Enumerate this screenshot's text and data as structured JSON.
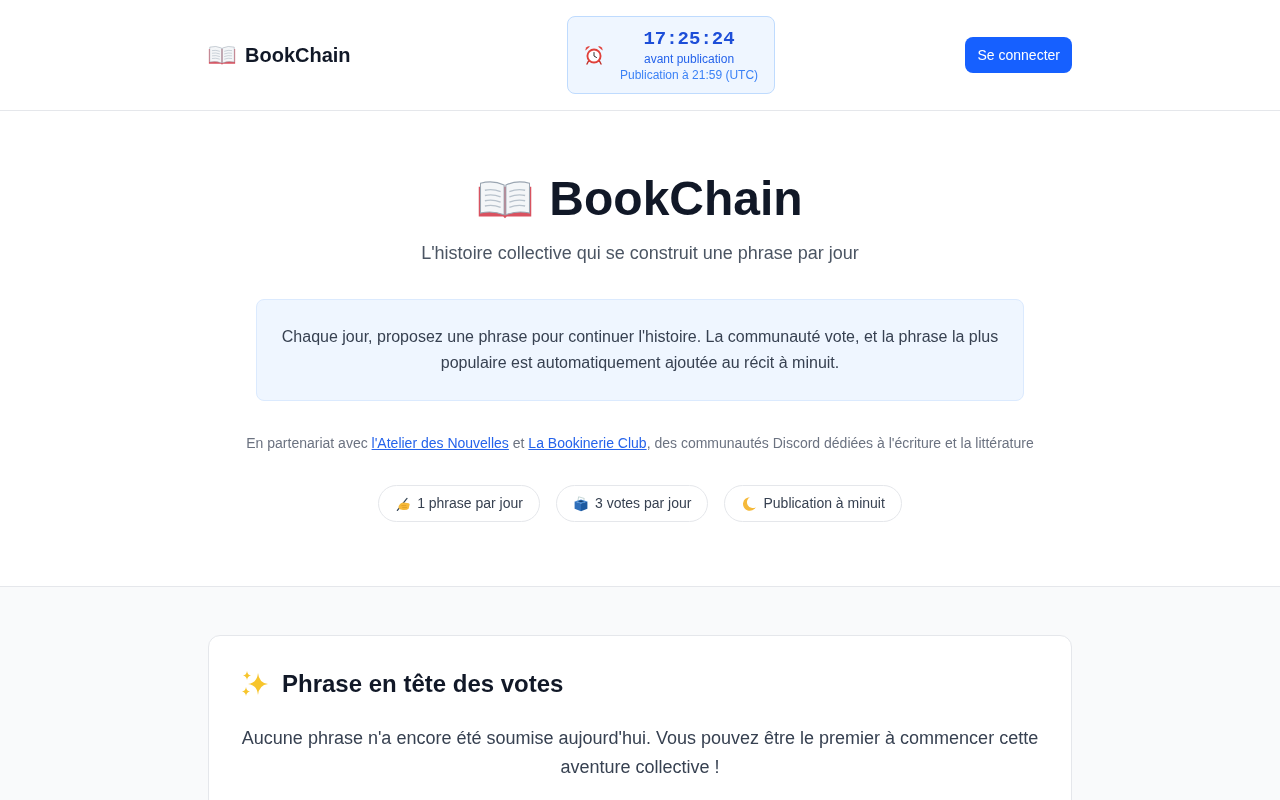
{
  "header": {
    "brand": "BookChain",
    "countdown": {
      "time": "17:25:24",
      "caption": "avant publication",
      "publication": "Publication à 21:59 (UTC)"
    },
    "login_button": "Se connecter"
  },
  "hero": {
    "title": "BookChain",
    "subtitle": "L'histoire collective qui se construit une phrase par jour",
    "intro": "Chaque jour, proposez une phrase pour continuer l'histoire. La communauté vote, et la phrase la plus populaire est automatiquement ajoutée au récit à minuit.",
    "partnership": [
      {
        "kind": "text",
        "text": "En partenariat avec "
      },
      {
        "kind": "link",
        "text": "l'Atelier des Nouvelles"
      },
      {
        "kind": "text",
        "text": " et "
      },
      {
        "kind": "link",
        "text": "La Bookinerie Club"
      },
      {
        "kind": "text",
        "text": ", des communautés Discord dédiées à l'écriture et la littérature"
      }
    ],
    "features": [
      {
        "label": "1 phrase par jour"
      },
      {
        "label": "3 votes par jour"
      },
      {
        "label": "Publication à minuit"
      }
    ]
  },
  "top_sentence": {
    "title": "Phrase en tête des votes",
    "message": "Aucune phrase n'a encore été soumise aujourd'hui. Vous pouvez être le premier à commencer cette aventure collective !"
  }
}
